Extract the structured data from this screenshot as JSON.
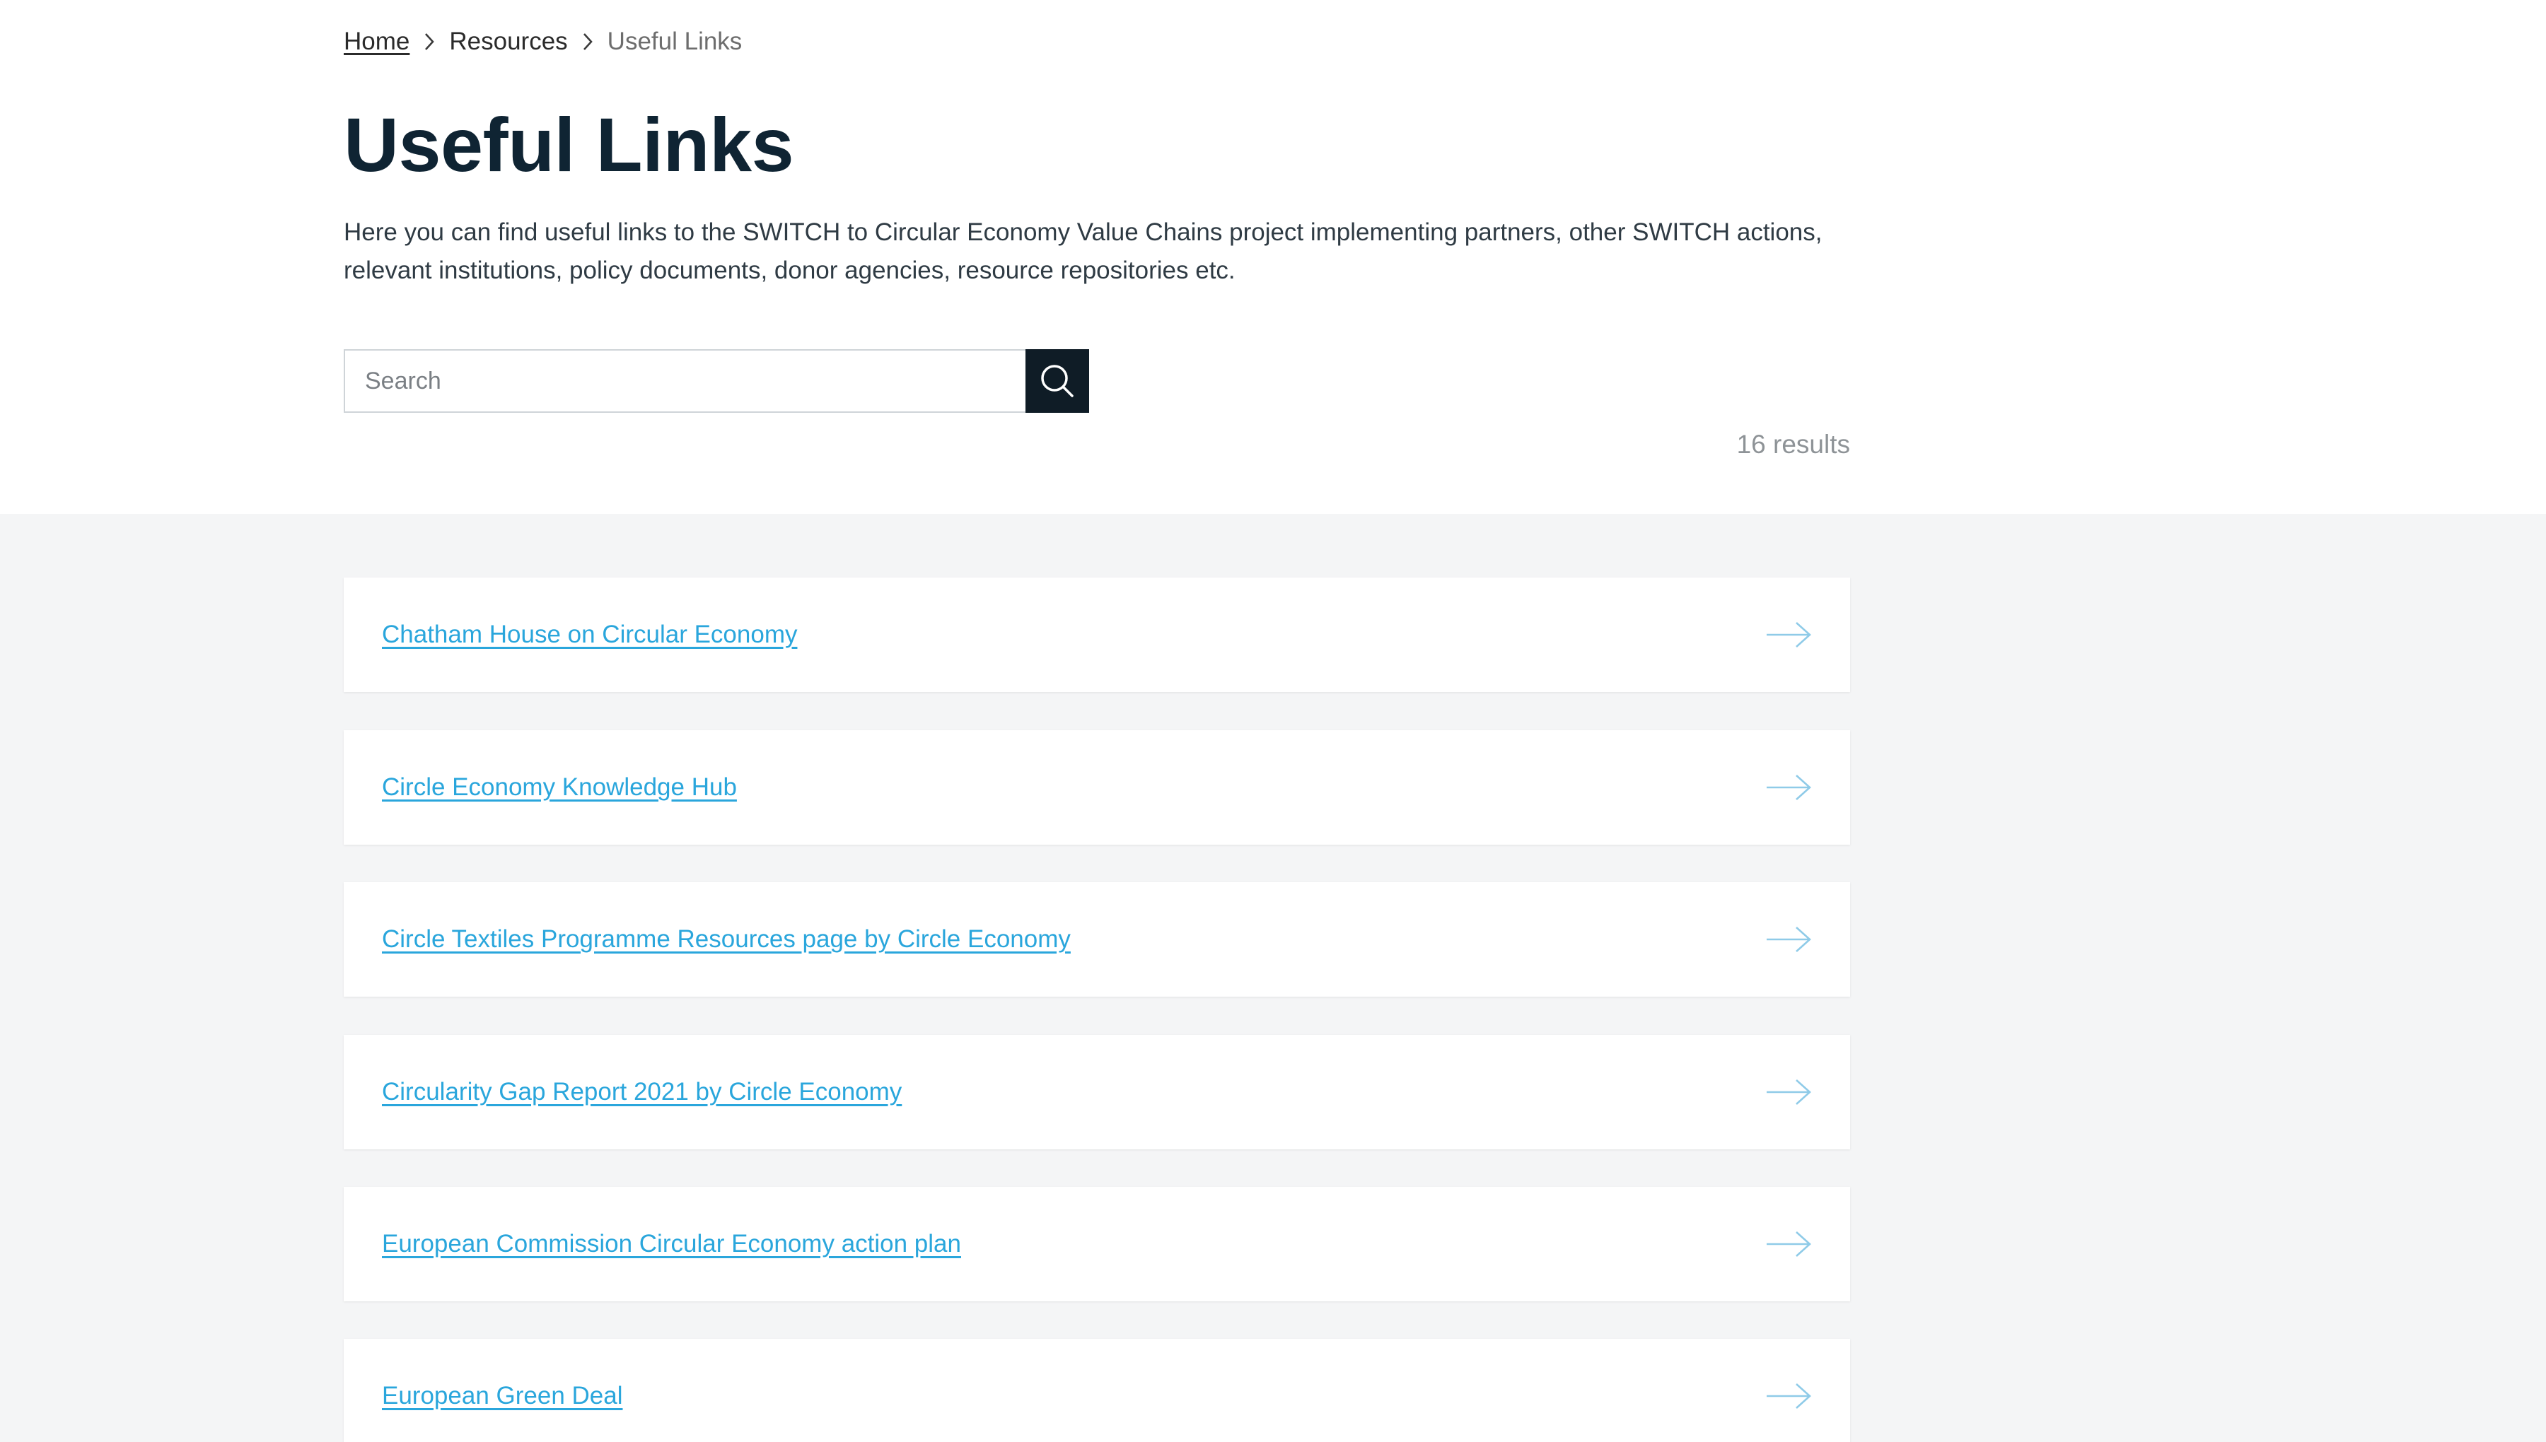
{
  "breadcrumb": {
    "home": "Home",
    "resources": "Resources",
    "current": "Useful Links"
  },
  "page": {
    "title": "Useful Links",
    "intro_line1": "Here you can find useful links to the SWITCH to Circular Economy Value Chains project implementing partners, other SWITCH actions,",
    "intro_line2": "relevant institutions, policy documents, donor agencies, resource repositories etc."
  },
  "search": {
    "placeholder": "Search",
    "value": ""
  },
  "results": {
    "count_label": "16 results"
  },
  "links": [
    {
      "label": "Chatham House on Circular Economy"
    },
    {
      "label": "Circle Economy Knowledge Hub"
    },
    {
      "label": "Circle Textiles Programme Resources page by Circle Economy"
    },
    {
      "label": "Circularity Gap Report 2021 by Circle Economy"
    },
    {
      "label": "European Commission Circular Economy action plan"
    },
    {
      "label": "European Green Deal"
    }
  ],
  "icons": {
    "breadcrumb_separator": "chevron-right-icon",
    "search": "search-icon",
    "link_arrow": "arrow-right-icon"
  },
  "colors": {
    "title": "#0f2433",
    "link": "#2aa6dc",
    "search_button": "#0f1c26",
    "list_background": "#f4f5f6",
    "arrow": "#8fcbe8"
  }
}
